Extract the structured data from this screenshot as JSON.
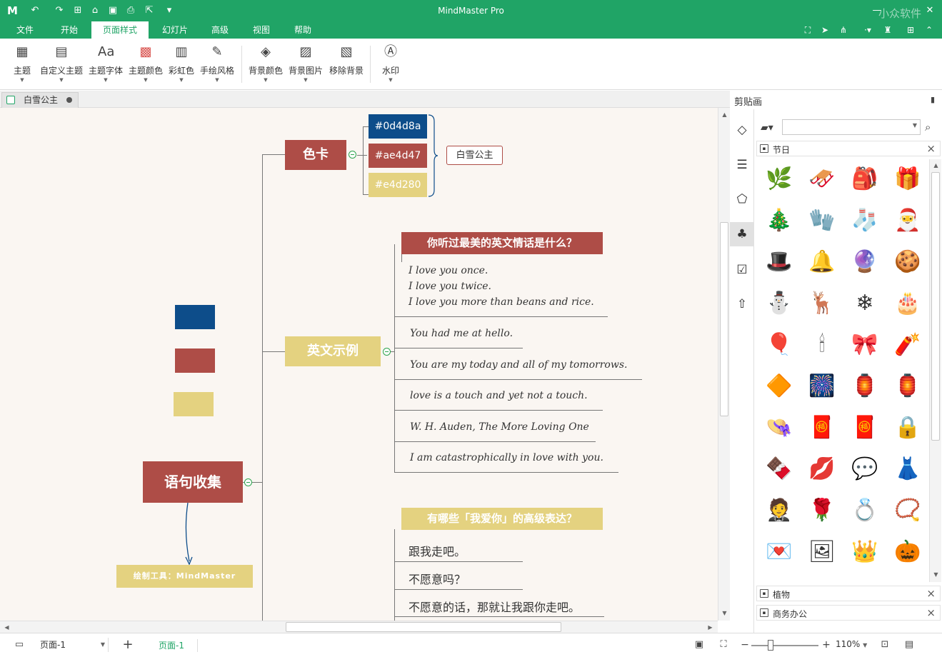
{
  "window": {
    "title": "MindMaster Pro",
    "watermark": "小众软件"
  },
  "menu": {
    "tabs": [
      {
        "label": "文件"
      },
      {
        "label": "开始"
      },
      {
        "label": "页面样式"
      },
      {
        "label": "幻灯片"
      },
      {
        "label": "高级"
      },
      {
        "label": "视图"
      },
      {
        "label": "帮助"
      }
    ],
    "active_index": 2
  },
  "ribbon": {
    "items": [
      {
        "label": "主题",
        "icon": "grid-icon"
      },
      {
        "label": "自定义主题",
        "icon": "custom-grid-icon"
      },
      {
        "label": "主题字体",
        "icon": "font-icon"
      },
      {
        "label": "主题颜色",
        "icon": "palette-icon"
      },
      {
        "label": "彩虹色",
        "icon": "rainbow-icon"
      },
      {
        "label": "手绘风格",
        "icon": "pen-icon"
      },
      {
        "label": "背景颜色",
        "icon": "paint-bucket-icon"
      },
      {
        "label": "背景图片",
        "icon": "image-icon"
      },
      {
        "label": "移除背景",
        "icon": "remove-image-icon"
      },
      {
        "label": "水印",
        "icon": "watermark-icon"
      }
    ]
  },
  "document": {
    "tab_name": "白雪公主"
  },
  "mindmap": {
    "root": "语句收集",
    "root_note": "绘制工具：MindMaster",
    "color_card": {
      "label": "色卡",
      "swatches": [
        {
          "label": "#0d4d8a",
          "color": "#0d4d8a"
        },
        {
          "label": "#ae4d47",
          "color": "#ae4d47"
        },
        {
          "label": "#e4d280",
          "color": "#e4d280"
        }
      ],
      "summary": "白雪公主"
    },
    "english": {
      "label": "英文示例",
      "topic": "你听过最美的英文情话是什么？",
      "lines": [
        "I love you once.",
        "I love you twice.",
        "I love you more than beans and rice.",
        "You had me at hello.",
        "You are my today and all of my tomorrows.",
        "love is a touch and yet not a touch.",
        "W. H. Auden, The More Loving One",
        "I am catastrophically in love with you."
      ]
    },
    "chinese": {
      "topic": "有哪些「我爱你」的高级表达？",
      "lines": [
        "跟我走吧。",
        "不愿意吗？",
        "不愿意的话，那就让我跟你走吧。"
      ]
    }
  },
  "sidebar": {
    "title": "剪贴画",
    "categories": [
      {
        "name": "节日"
      },
      {
        "name": "植物"
      },
      {
        "name": "商务办公"
      }
    ],
    "clipart": [
      "holly",
      "sleigh",
      "santa-bag",
      "gift",
      "christmas-tree",
      "mitten",
      "stocking",
      "santa",
      "santa-hat",
      "bell",
      "ornament",
      "gingerbread",
      "snowman",
      "reindeer",
      "snowflake",
      "cake",
      "balloon",
      "candle",
      "antlers",
      "firecracker",
      "chinese-knot",
      "firework",
      "lantern",
      "red-lantern",
      "hat",
      "fu-sign",
      "red-envelope",
      "lock-heart",
      "chocolate",
      "lips",
      "chat",
      "dress",
      "tuxedo",
      "rose",
      "ring",
      "necklace",
      "letter",
      "photo",
      "crown",
      "pumpkin"
    ],
    "clipart_glyphs": [
      "🌿",
      "🛷",
      "🎒",
      "🎁",
      "🎄",
      "🧤",
      "🧦",
      "🎅",
      "🎩",
      "🔔",
      "🔮",
      "🍪",
      "⛄",
      "🦌",
      "❄",
      "🎂",
      "🎈",
      "🕯",
      "🎀",
      "🧨",
      "🔶",
      "🎆",
      "🏮",
      "🏮",
      "👒",
      "🧧",
      "🧧",
      "🔒",
      "🍫",
      "💋",
      "💬",
      "👗",
      "🤵",
      "🌹",
      "💍",
      "📿",
      "💌",
      "🖼",
      "👑",
      "🎃"
    ]
  },
  "status": {
    "page_select": "页面-1",
    "page_tab": "页面-1",
    "zoom": "110%"
  },
  "colors": {
    "brand": "#20a466",
    "root": "#ae4d47",
    "topic_red": "#ae4d47",
    "topic_yellow": "#e4d280",
    "canvas_bg": "#faf6f2"
  }
}
